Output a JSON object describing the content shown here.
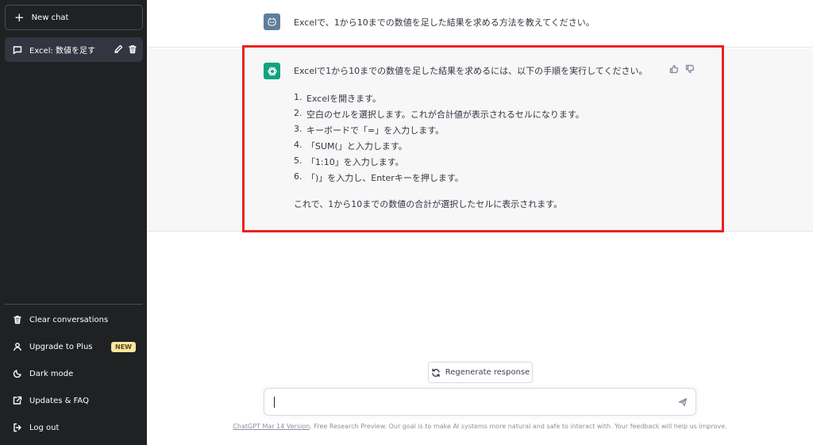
{
  "sidebar": {
    "new_chat_label": "New chat",
    "conversations": [
      {
        "title": "Excel: 数値を足す"
      }
    ],
    "links": [
      {
        "label": "Clear conversations",
        "icon": "trash-icon"
      },
      {
        "label": "Upgrade to Plus",
        "icon": "user-icon",
        "badge": "NEW"
      },
      {
        "label": "Dark mode",
        "icon": "moon-icon"
      },
      {
        "label": "Updates & FAQ",
        "icon": "external-link-icon"
      },
      {
        "label": "Log out",
        "icon": "logout-icon"
      }
    ]
  },
  "conversation": {
    "user_message": "Excelで、1から10までの数値を足した結果を求める方法を教えてください。",
    "assistant": {
      "intro": "Excelで1から10までの数値を足した結果を求めるには、以下の手順を実行してください。",
      "steps": [
        {
          "num": "1.",
          "text": "Excelを開きます。"
        },
        {
          "num": "2.",
          "text": "空白のセルを選択します。これが合計値が表示されるセルになります。"
        },
        {
          "num": "3.",
          "text": "キーボードで「=」を入力します。"
        },
        {
          "num": "4.",
          "text": "「SUM(」と入力します。"
        },
        {
          "num": "5.",
          "text": "「1:10」を入力します。"
        },
        {
          "num": "6.",
          "text": "「)」を入力し、Enterキーを押します。"
        }
      ],
      "outro": "これで、1から10までの数値の合計が選択したセルに表示されます。"
    }
  },
  "composer": {
    "regenerate_label": "Regenerate response",
    "input_value": ""
  },
  "footer": {
    "version_link": "ChatGPT Mar 14 Version",
    "text": ". Free Research Preview. Our goal is to make AI systems more natural and safe to interact with. Your feedback will help us improve."
  },
  "colors": {
    "sidebar_bg": "#202123",
    "assistant_avatar": "#10a37f",
    "highlight": "#e8231f",
    "badge_bg": "#fae69e"
  }
}
